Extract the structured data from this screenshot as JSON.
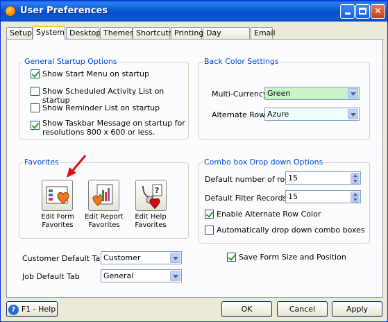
{
  "window": {
    "title": "User Preferences"
  },
  "tabs": [
    "Setup",
    "System",
    "Desktop",
    "Themes",
    "Shortcuts",
    "Printing",
    "Day Planner",
    "Email"
  ],
  "active_tab": "System",
  "startup": {
    "title": "General Startup Options",
    "items": [
      {
        "label": "Show Start Menu on startup",
        "checked": true
      },
      {
        "label": "Show Scheduled Activity List on startup",
        "checked": false
      },
      {
        "label": "Show Reminder List on startup",
        "checked": false
      },
      {
        "label_line1": "Show Taskbar Message on startup for",
        "label_line2": "resolutions 800 x 600 or less.",
        "checked": true
      }
    ]
  },
  "backcolor": {
    "title": "Back Color Settings",
    "multi_currency_label": "Multi-Currency",
    "multi_currency_value": "Green",
    "multi_currency_color": "#c8f5c8",
    "alternate_row_label": "Alternate Row",
    "alternate_row_value": "Azure",
    "alternate_row_color": "#f0ffff"
  },
  "favorites": {
    "title": "Favorites",
    "buttons": [
      {
        "line1": "Edit Form",
        "line2": "Favorites"
      },
      {
        "line1": "Edit Report",
        "line2": "Favorites"
      },
      {
        "line1": "Edit Help",
        "line2": "Favorites"
      }
    ]
  },
  "combobox": {
    "title": "Combo box Drop down Options",
    "rows_label": "Default number of rows",
    "rows_value": "15",
    "filter_label": "Default Filter Records",
    "filter_value": "15",
    "alt_row_color_label": "Enable Alternate Row Color",
    "alt_row_color_checked": true,
    "auto_drop_label": "Automatically drop down combo boxes",
    "auto_drop_checked": false
  },
  "customer_tab": {
    "label": "Customer Default Tab",
    "value": "Customer"
  },
  "job_tab": {
    "label": "Job Default Tab",
    "value": "General"
  },
  "save_form": {
    "label": "Save Form Size and Position",
    "checked": true
  },
  "footer": {
    "help": "F1 - Help",
    "ok": "OK",
    "cancel": "Cancel",
    "apply": "Apply"
  },
  "annotation_arrow_color": "#e01010"
}
